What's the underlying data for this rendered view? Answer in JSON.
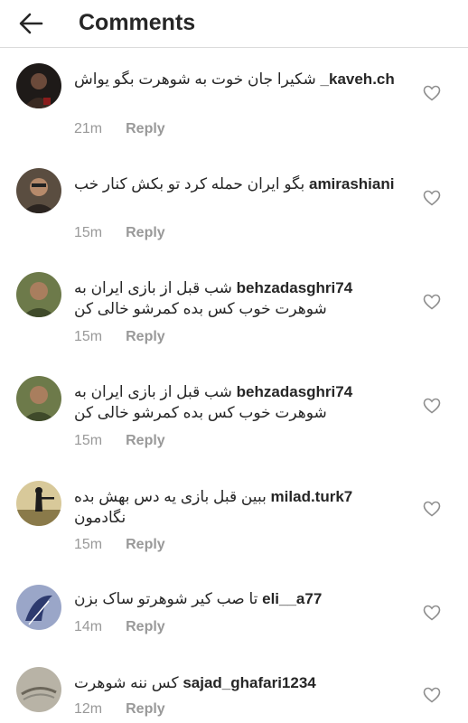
{
  "header": {
    "title": "Comments"
  },
  "comments": [
    {
      "username": "_kaveh.ch",
      "text": "شکیرا جان خوت به شوهرت بگو یواش",
      "time": "21m",
      "reply_label": "Reply",
      "avatar_color": "#3a2a22"
    },
    {
      "username": "amirashiani",
      "text": "بگو ایران حمله کرد تو بکش کنار خب",
      "time": "15m",
      "reply_label": "Reply",
      "avatar_color": "#4a3f36"
    },
    {
      "username": "behzadasghri74",
      "text": "شب قبل از بازی ایران به شوهرت خوب کس بده کمرشو خالی کن",
      "time": "15m",
      "reply_label": "Reply",
      "avatar_color": "#5b6b3a"
    },
    {
      "username": "behzadasghri74",
      "text": "شب قبل از بازی ایران به شوهرت خوب کس بده کمرشو خالی کن",
      "time": "15m",
      "reply_label": "Reply",
      "avatar_color": "#5b6b3a"
    },
    {
      "username": "milad.turk7",
      "text": "ببین قبل بازی یه دس بهش بده نگادمون",
      "time": "15m",
      "reply_label": "Reply",
      "avatar_color": "#c9b98a"
    },
    {
      "username": "eli__a77",
      "text": "تا صب کیر شوهرتو ساک بزن",
      "time": "14m",
      "reply_label": "Reply",
      "avatar_color": "#2d3a6e"
    },
    {
      "username": "sajad_ghafari1234",
      "text": "کس ننه شوهرت",
      "time": "12m",
      "reply_label": "Reply",
      "avatar_color": "#8d8a80"
    }
  ]
}
